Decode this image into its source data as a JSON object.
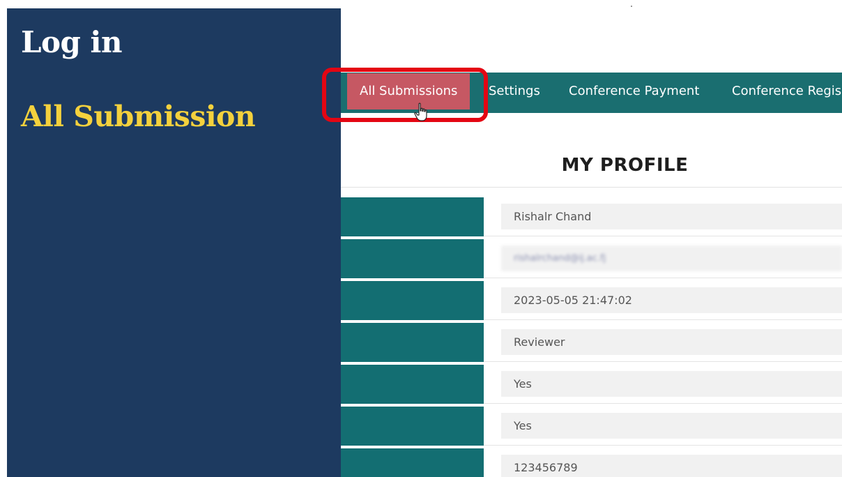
{
  "side_panel": {
    "title": "Log in",
    "subtitle": "All Submission"
  },
  "nav": {
    "items": [
      {
        "label": "All Submissions",
        "active": true
      },
      {
        "label": "Settings"
      },
      {
        "label": "Conference Payment"
      },
      {
        "label": "Conference Regis"
      }
    ]
  },
  "profile": {
    "title": "MY PROFILE",
    "rows": [
      {
        "value": "Rishalr Chand"
      },
      {
        "value": "rishalrchand@ij.ac.fj",
        "blurred": true
      },
      {
        "value": "2023-05-05 21:47:02"
      },
      {
        "value": "Reviewer"
      },
      {
        "value": "Yes"
      },
      {
        "value": "Yes"
      },
      {
        "value": "123456789"
      }
    ]
  },
  "colors": {
    "side_panel_bg": "#1d3a60",
    "subtitle": "#f4d13d",
    "navbar": "#1a6e70",
    "active_tab": "#c65863",
    "highlight": "#e40613",
    "row_label": "#136e72"
  },
  "icons": {
    "cursor": "hand-pointer-cursor-icon"
  }
}
